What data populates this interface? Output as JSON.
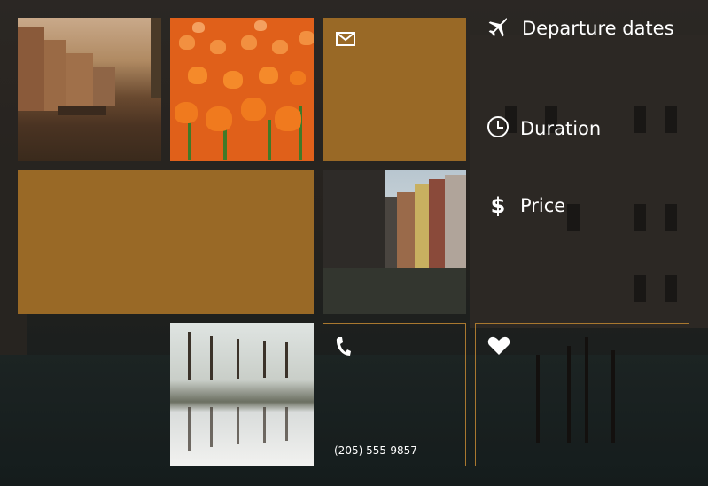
{
  "menu": {
    "departure": {
      "label": "Departure dates",
      "icon": "airplane-icon"
    },
    "duration": {
      "label": "Duration",
      "icon": "clock-icon"
    },
    "price": {
      "label": "Price",
      "icon": "dollar-icon"
    }
  },
  "tiles": {
    "mail": {
      "icon": "mail-icon"
    },
    "phone": {
      "icon": "phone-icon",
      "number": "(205) 555-9857"
    },
    "favorite": {
      "icon": "heart-icon"
    },
    "photos": [
      "amsterdam-canal-photo",
      "tulips-photo",
      "canal-houses-photo",
      "park-reflection-photo"
    ]
  },
  "colors": {
    "accent": "#996926",
    "outline": "#a9782f",
    "text": "#ffffff"
  }
}
